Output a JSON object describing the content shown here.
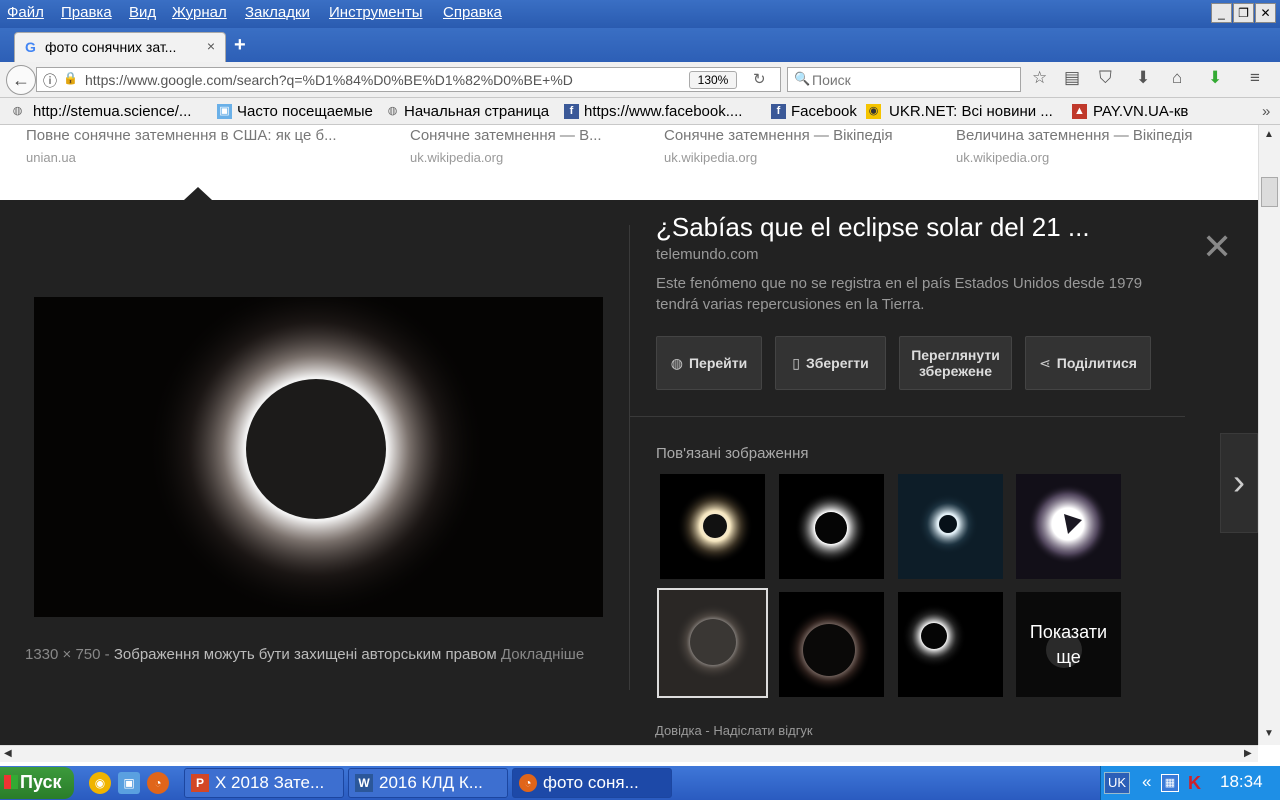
{
  "menu": [
    "Файл",
    "Правка",
    "Вид",
    "Журнал",
    "Закладки",
    "Инструменты",
    "Справка"
  ],
  "tab": {
    "title": "фото сонячних зат...",
    "close": "×",
    "new": "+"
  },
  "nav": {
    "url": "https://www.google.com/search?q=%D1%84%D0%BE%D1%82%D0%BE+%D",
    "zoom": "130%",
    "search_placeholder": "Поиск"
  },
  "bookmarks": [
    {
      "label": "http://stemua.science/...",
      "icon": "globe-icon"
    },
    {
      "label": "Часто посещаемые",
      "icon": "folder-icon"
    },
    {
      "label": "Начальная страница",
      "icon": "globe-icon"
    },
    {
      "label": "https://www.facebook....",
      "icon": "facebook-icon"
    },
    {
      "label": "Facebook",
      "icon": "facebook-icon"
    },
    {
      "label": "UKR.NET: Всі новини ...",
      "icon": "ukrnet-icon"
    },
    {
      "label": "PAY.VN.UA-кв",
      "icon": "payvn-icon"
    }
  ],
  "results": [
    {
      "title": "Повне сонячне затемнення в США: як це б...",
      "domain": "unian.ua"
    },
    {
      "title": "Сонячне затемнення — В...",
      "domain": "uk.wikipedia.org"
    },
    {
      "title": "Сонячне затемнення — Вікіпедія",
      "domain": "uk.wikipedia.org"
    },
    {
      "title": "Величина затемнення — Вікіпедія",
      "domain": "uk.wikipedia.org"
    }
  ],
  "panel": {
    "title": "¿Sabías que el eclipse solar del 21 ...",
    "source": "telemundo.com",
    "description": "Este fenómeno que no se registra en el país Estados Unidos desde 1979 tendrá varias repercusiones en la Tierra.",
    "buttons": {
      "visit": "Перейти",
      "save": "Зберегти",
      "view_saved": "Переглянути збережене",
      "share": "Поділитися"
    },
    "image_size": "1330 × 750",
    "separator": "-",
    "copyright": "Зображення можуть бути захищені авторським правом",
    "details": "Докладніше",
    "related_heading": "Пов'язані зображення",
    "more_label": "Показати ще",
    "footer_help": "Довідка",
    "footer_feedback": "Надіслати відгук"
  },
  "taskbar": {
    "start": "Пуск",
    "tasks": [
      {
        "label": "X 2018 Зате...",
        "icon": "powerpoint-icon"
      },
      {
        "label": "2016 КЛД К...",
        "icon": "word-icon"
      },
      {
        "label": "фото соня...",
        "icon": "firefox-icon"
      }
    ],
    "lang": "UK",
    "clock": "18:34"
  },
  "colors": {
    "panel_bg": "#222222",
    "xp_blue": "#2a5bb0",
    "start_green": "#2a7d2a"
  }
}
